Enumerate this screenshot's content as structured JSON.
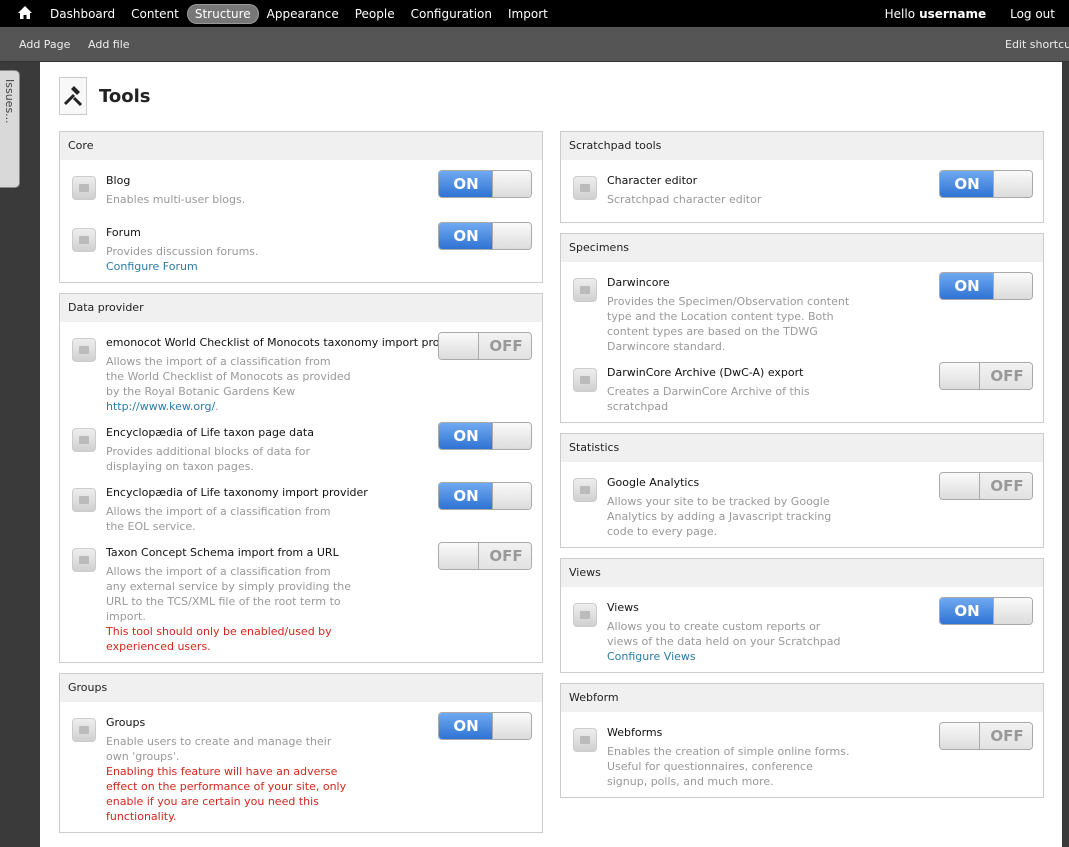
{
  "topbar": {
    "nav": [
      "Dashboard",
      "Content",
      "Structure",
      "Appearance",
      "People",
      "Configuration",
      "Import"
    ],
    "active": "Structure",
    "hello": "Hello",
    "username": "username",
    "logout": "Log out"
  },
  "shortcuts": {
    "add_page": "Add Page",
    "add_file": "Add file",
    "edit_shortcuts": "Edit shortcuts"
  },
  "issues_tab": "Issues...",
  "page": {
    "title": "Tools"
  },
  "left": [
    {
      "legend": "Core",
      "modules": [
        {
          "name": "Blog",
          "desc": "Enables multi-user blogs.",
          "state": "ON"
        },
        {
          "name": "Forum",
          "desc": "Provides discussion forums.",
          "link": "Configure Forum",
          "state": "ON"
        }
      ]
    },
    {
      "legend": "Data provider",
      "modules": [
        {
          "name": "emonocot World Checklist of Monocots taxonomy import provider",
          "desc": "Allows the import of a classification from the World Checklist of Monocots as provided by the Royal Botanic Gardens Kew",
          "link": "http://www.kew.org/",
          "link_suffix": ".",
          "state": "OFF"
        },
        {
          "name": "Encyclopædia of Life taxon page data",
          "desc": "Provides additional blocks of data for displaying on taxon pages.",
          "state": "ON"
        },
        {
          "name": "Encyclopædia of Life taxonomy import provider",
          "desc": "Allows the import of a classification from the EOL service.",
          "state": "ON"
        },
        {
          "name": "Taxon Concept Schema import from a URL",
          "desc": "Allows the import of a classification from any external service by simply providing the URL to the TCS/XML file of the root term to import.",
          "warn": "This tool should only be enabled/used by experienced users.",
          "state": "OFF"
        }
      ]
    },
    {
      "legend": "Groups",
      "modules": [
        {
          "name": "Groups",
          "desc": "Enable users to create and manage their own 'groups'.",
          "warn": "Enabling this feature will have an adverse effect on the performance of your site, only enable if you are certain you need this functionality.",
          "state": "ON"
        }
      ]
    }
  ],
  "right": [
    {
      "legend": "Scratchpad tools",
      "modules": [
        {
          "name": "Character editor",
          "desc": "Scratchpad character editor",
          "state": "ON"
        }
      ]
    },
    {
      "legend": "Specimens",
      "modules": [
        {
          "name": "Darwincore",
          "desc": "Provides the Specimen/Observation content type and the Location content type. Both content types are based on the TDWG Darwincore standard.",
          "state": "ON"
        },
        {
          "name": "DarwinCore Archive (DwC-A) export",
          "desc": "Creates a DarwinCore Archive of this scratchpad",
          "state": "OFF"
        }
      ]
    },
    {
      "legend": "Statistics",
      "modules": [
        {
          "name": "Google Analytics",
          "desc": "Allows your site to be tracked by Google Analytics by adding a Javascript tracking code to every page.",
          "state": "OFF"
        }
      ]
    },
    {
      "legend": "Views",
      "modules": [
        {
          "name": "Views",
          "desc": "Allows you to create custom reports or views of the data held on your Scratchpad",
          "link": "Configure Views",
          "state": "ON"
        }
      ]
    },
    {
      "legend": "Webform",
      "modules": [
        {
          "name": "Webforms",
          "desc": "Enables the creation of simple online forms. Useful for questionnaires, conference signup, polls, and much more.",
          "state": "OFF"
        }
      ]
    }
  ]
}
